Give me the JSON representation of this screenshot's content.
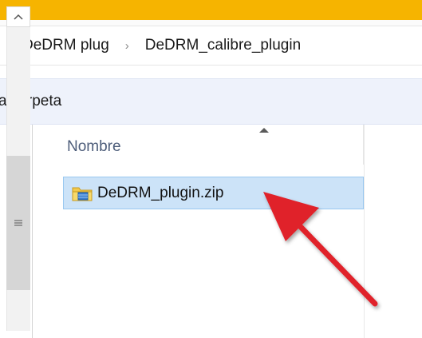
{
  "window": {
    "title_bar_color": "#f6b400"
  },
  "breadcrumb": {
    "items": [
      "DeDRM plug",
      "DeDRM_calibre_plugin"
    ],
    "separator": "›"
  },
  "command_bar": {
    "new_folder_label": "a carpeta"
  },
  "file_list": {
    "columns": [
      {
        "label": "Nombre",
        "sorted": "ascending"
      }
    ],
    "rows": [
      {
        "name": "DeDRM_plugin.zip",
        "icon": "zip-folder-icon",
        "selected": true
      }
    ]
  },
  "annotation": {
    "arrow_color": "#e0202a",
    "arrow_icon": "red-arrow-icon"
  },
  "colors": {
    "selection_fill": "#cce3f8",
    "selection_border": "#99c8f0",
    "command_bar_bg": "#eef2fb"
  }
}
